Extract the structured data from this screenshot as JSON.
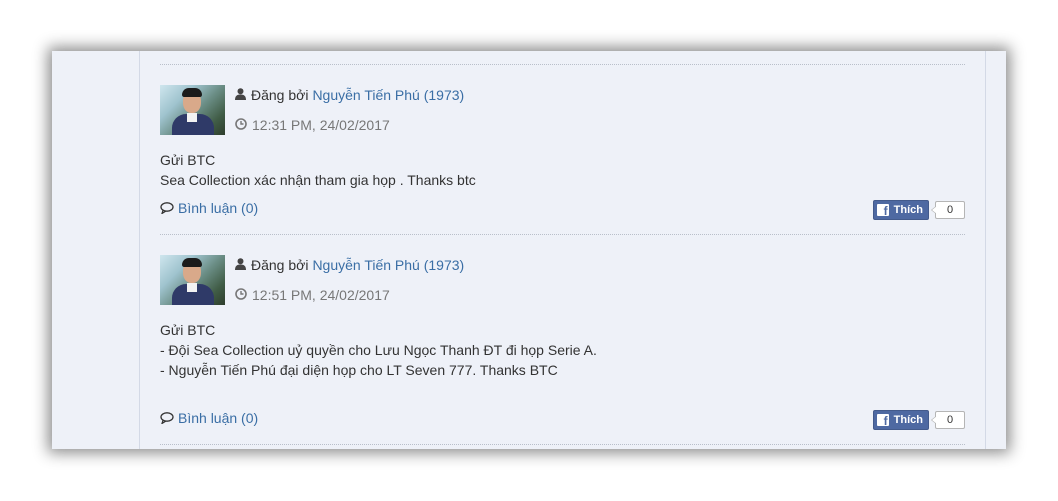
{
  "posts": [
    {
      "posted_by_label": "Đăng bởi",
      "author": "Nguyễn Tiến Phú (1973)",
      "timestamp": "12:31 PM, 24/02/2017",
      "lines": [
        "Gửi BTC",
        "Sea Collection xác nhận tham gia họp . Thanks btc"
      ],
      "comments_label": "Bình luận (0)",
      "like_label": "Thích",
      "like_count": "0"
    },
    {
      "posted_by_label": "Đăng bởi",
      "author": "Nguyễn Tiến Phú (1973)",
      "timestamp": "12:51 PM, 24/02/2017",
      "lines": [
        "Gửi BTC",
        "- Đội Sea Collection uỷ quyền cho Lưu Ngọc Thanh ĐT đi họp Serie A.",
        "- Nguyễn Tiến Phú đại diện họp cho LT Seven 777. Thanks BTC"
      ],
      "comments_label": "Bình luận (0)",
      "like_label": "Thích",
      "like_count": "0"
    }
  ],
  "colors": {
    "link": "#3a6ea5",
    "text": "#333333",
    "muted": "#777777",
    "facebook": "#4e69a2",
    "panel_bg": "#eef1f8"
  },
  "icons": [
    "user-icon",
    "clock-icon",
    "comment-icon",
    "facebook-icon"
  ]
}
